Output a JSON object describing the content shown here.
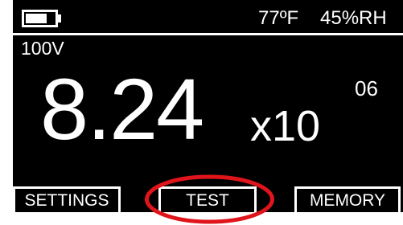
{
  "status": {
    "battery_icon": "battery-icon",
    "battery_level": 0.75,
    "temperature": "77ºF",
    "humidity": "45%RH"
  },
  "test_voltage": "100V",
  "reading": {
    "mantissa": "8.24",
    "base": "x10",
    "exponent": "06"
  },
  "softkeys": {
    "settings": "SETTINGS",
    "test": "TEST",
    "memory": "MEMORY"
  },
  "colors": {
    "screen_background": "#000000",
    "text": "#ffffff",
    "highlight_ring": "#e0141b"
  }
}
